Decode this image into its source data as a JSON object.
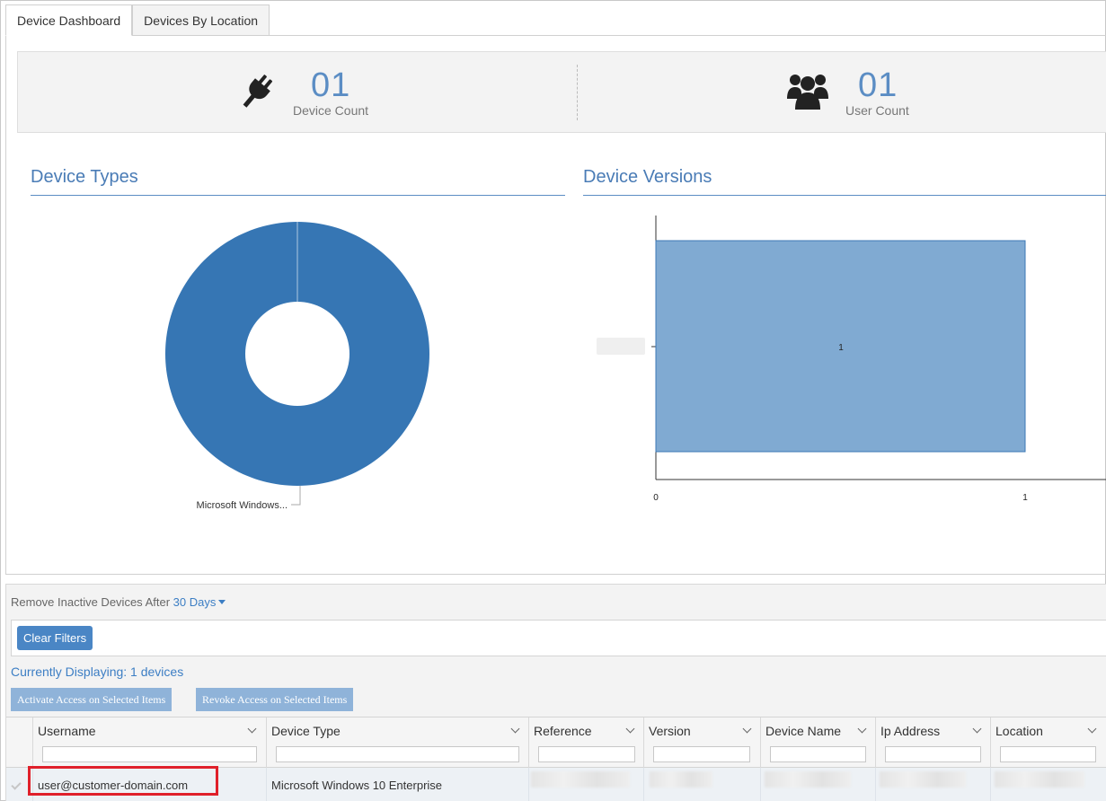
{
  "tabs": [
    {
      "label": "Device Dashboard",
      "active": true
    },
    {
      "label": "Devices By Location",
      "active": false
    }
  ],
  "stats": {
    "device": {
      "value": "01",
      "label": "Device Count",
      "icon": "plug-icon"
    },
    "user": {
      "value": "01",
      "label": "User Count",
      "icon": "users-icon"
    }
  },
  "device_types": {
    "title": "Device Types",
    "slice_label": "Microsoft Windows..."
  },
  "device_versions": {
    "title": "Device Versions",
    "bar_label": "1",
    "x_tick_0": "0",
    "x_tick_1": "1"
  },
  "chart_data": [
    {
      "type": "pie",
      "title": "Device Types",
      "categories": [
        "Microsoft Windows..."
      ],
      "values": [
        1
      ],
      "donut": true,
      "colors": [
        "#3676b4"
      ]
    },
    {
      "type": "bar",
      "orientation": "horizontal",
      "title": "Device Versions",
      "categories": [
        ""
      ],
      "values": [
        1
      ],
      "xlim": [
        0,
        1.2
      ],
      "x_ticks": [
        0,
        1
      ],
      "colors": [
        "#80aad2"
      ]
    }
  ],
  "inactive": {
    "prefix": "Remove Inactive Devices After",
    "value": "30 Days"
  },
  "buttons": {
    "clear_filters": "Clear Filters",
    "activate": "Activate Access on Selected Items",
    "revoke": "Revoke Access on Selected Items"
  },
  "displaying": "Currently Displaying: 1 devices",
  "columns": [
    "Username",
    "Device Type",
    "Reference",
    "Version",
    "Device Name",
    "Ip Address",
    "Location"
  ],
  "row": {
    "username": "user@customer-domain.com",
    "device_type": "Microsoft Windows 10 Enterprise"
  },
  "colors": {
    "accent": "#4a7cb6",
    "donut": "#3676b4",
    "bar": "#80aad2",
    "highlight": "#e0202a"
  }
}
